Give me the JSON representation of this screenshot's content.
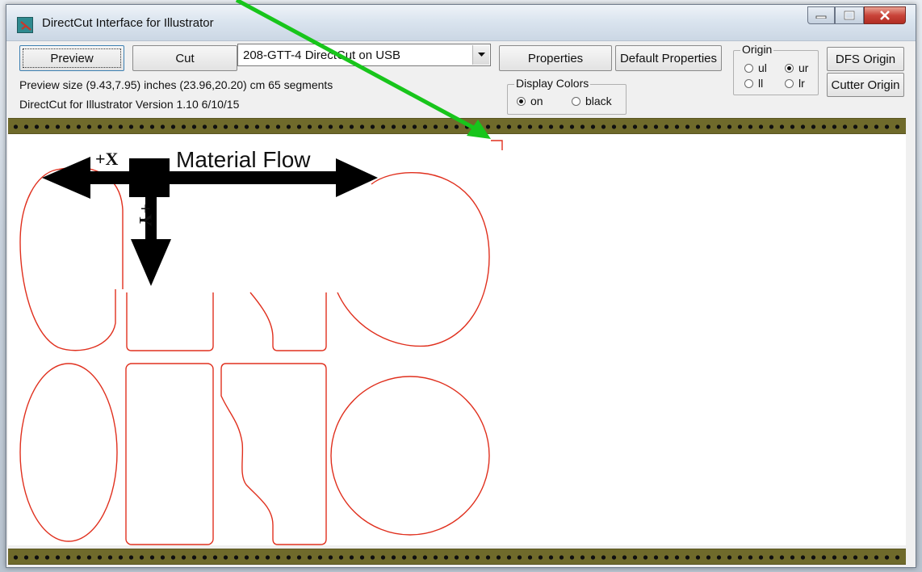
{
  "window": {
    "title": "DirectCut Interface for Illustrator"
  },
  "toolbar": {
    "preview_label": "Preview",
    "cut_label": "Cut",
    "device_selected": "208-GTT-4 DirectCut on USB",
    "properties_label": "Properties",
    "default_properties_label": "Default Properties",
    "dfs_origin_label": "DFS Origin",
    "cutter_origin_label": "Cutter Origin"
  },
  "info": {
    "preview_size": "Preview size (9.43,7.95) inches  (23.96,20.20) cm   65 segments",
    "version": "DirectCut for Illustrator Version 1.10 6/10/15"
  },
  "display_colors": {
    "label": "Display Colors",
    "options": [
      "on",
      "black"
    ],
    "selected": "on"
  },
  "origin": {
    "label": "Origin",
    "options": [
      "ul",
      "ur",
      "ll",
      "lr"
    ],
    "selected": "ur"
  },
  "annotation": {
    "flow_label": "Material Flow",
    "x_label": "+X",
    "y_label": "+Y",
    "arrow_color": "#18c51b"
  },
  "colors": {
    "cut_path": "#e0301e",
    "strip": "#6f6a2b"
  }
}
